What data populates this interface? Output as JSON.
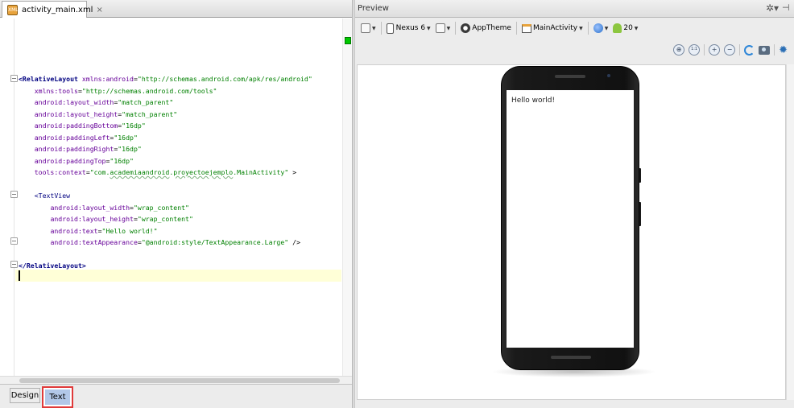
{
  "editor": {
    "tab_label": "activity_main.xml",
    "tab_close": "×",
    "file_icon_text": "XML",
    "lines": [
      {
        "i": 0,
        "parts": [
          [
            "tag",
            "<RelativeLayout "
          ],
          [
            "attr",
            "xmlns:android"
          ],
          [
            "plain",
            "="
          ],
          [
            "val",
            "\"http://schemas.android.com/apk/res/android\""
          ]
        ]
      },
      {
        "i": 1,
        "parts": [
          [
            "plain",
            "    "
          ],
          [
            "attr",
            "xmlns:tools"
          ],
          [
            "plain",
            "="
          ],
          [
            "val",
            "\"http://schemas.android.com/tools\""
          ]
        ]
      },
      {
        "i": 2,
        "parts": [
          [
            "plain",
            "    "
          ],
          [
            "attr",
            "android:layout_width"
          ],
          [
            "plain",
            "="
          ],
          [
            "val",
            "\"match_parent\""
          ]
        ]
      },
      {
        "i": 3,
        "parts": [
          [
            "plain",
            "    "
          ],
          [
            "attr",
            "android:layout_height"
          ],
          [
            "plain",
            "="
          ],
          [
            "val",
            "\"match_parent\""
          ]
        ]
      },
      {
        "i": 4,
        "parts": [
          [
            "plain",
            "    "
          ],
          [
            "attr",
            "android:paddingBottom"
          ],
          [
            "plain",
            "="
          ],
          [
            "val",
            "\"16dp\""
          ]
        ]
      },
      {
        "i": 5,
        "parts": [
          [
            "plain",
            "    "
          ],
          [
            "attr",
            "android:paddingLeft"
          ],
          [
            "plain",
            "="
          ],
          [
            "val",
            "\"16dp\""
          ]
        ]
      },
      {
        "i": 6,
        "parts": [
          [
            "plain",
            "    "
          ],
          [
            "attr",
            "android:paddingRight"
          ],
          [
            "plain",
            "="
          ],
          [
            "val",
            "\"16dp\""
          ]
        ]
      },
      {
        "i": 7,
        "parts": [
          [
            "plain",
            "    "
          ],
          [
            "attr",
            "android:paddingTop"
          ],
          [
            "plain",
            "="
          ],
          [
            "val",
            "\"16dp\""
          ]
        ]
      },
      {
        "i": 8,
        "parts": [
          [
            "plain",
            "    "
          ],
          [
            "attr",
            "tools:context"
          ],
          [
            "plain",
            "="
          ],
          [
            "val",
            "\"com."
          ],
          [
            "valu",
            "academiaandroid"
          ],
          [
            "val",
            "."
          ],
          [
            "valu",
            "proyectoejemplo"
          ],
          [
            "val",
            ".MainActivity\""
          ],
          [
            "plain",
            " >"
          ]
        ]
      },
      {
        "i": 9,
        "parts": []
      },
      {
        "i": 10,
        "parts": [
          [
            "plain",
            "    "
          ],
          [
            "tagn",
            "<TextView"
          ]
        ]
      },
      {
        "i": 11,
        "parts": [
          [
            "plain",
            "        "
          ],
          [
            "attr",
            "android:layout_width"
          ],
          [
            "plain",
            "="
          ],
          [
            "val",
            "\"wrap_content\""
          ]
        ]
      },
      {
        "i": 12,
        "parts": [
          [
            "plain",
            "        "
          ],
          [
            "attr",
            "android:layout_height"
          ],
          [
            "plain",
            "="
          ],
          [
            "val",
            "\"wrap_content\""
          ]
        ]
      },
      {
        "i": 13,
        "parts": [
          [
            "plain",
            "        "
          ],
          [
            "attr",
            "android:text"
          ],
          [
            "plain",
            "="
          ],
          [
            "val",
            "\"Hello world!\""
          ]
        ]
      },
      {
        "i": 14,
        "parts": [
          [
            "plain",
            "        "
          ],
          [
            "attr",
            "android:textAppearance"
          ],
          [
            "plain",
            "="
          ],
          [
            "val",
            "\"@android:style/TextAppearance.Large\""
          ],
          [
            "plain",
            " />"
          ]
        ]
      },
      {
        "i": 15,
        "parts": []
      },
      {
        "i": 16,
        "parts": [
          [
            "tag",
            "</RelativeLayout>"
          ]
        ]
      }
    ],
    "bottom_tabs": {
      "design": "Design",
      "text": "Text"
    }
  },
  "preview": {
    "title": "Preview",
    "gear_icon": "✲▾",
    "pin_icon": "⊣",
    "toolbar": {
      "device": "Nexus 6",
      "theme": "AppTheme",
      "activity": "MainActivity",
      "api": "20"
    },
    "zoom_labels": [
      "⊕",
      "1:1",
      "+",
      "−"
    ],
    "screen_text": "Hello world!"
  },
  "colors": {
    "tag": "#000080",
    "attr": "#660099",
    "value": "#008000",
    "highlight_box": "#e03a3a",
    "selected_tab": "#b2c7e8"
  }
}
